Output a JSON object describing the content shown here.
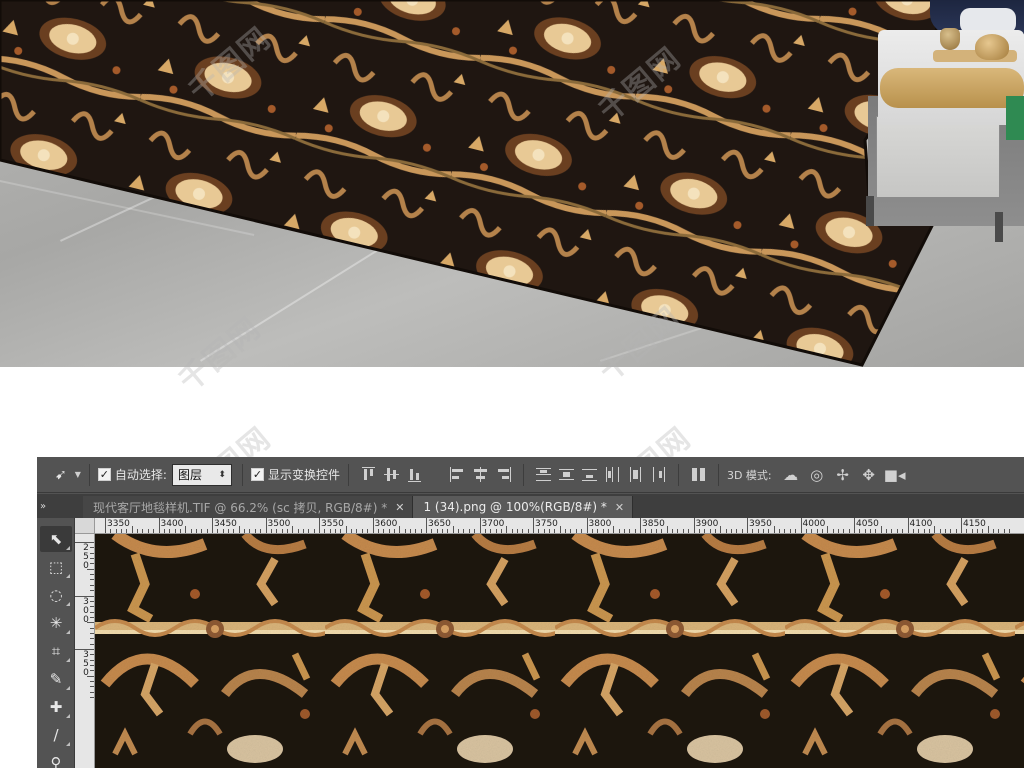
{
  "colors": {
    "rug_dark": "#1f1611",
    "rug_gold": "#c9975a",
    "rug_light": "#f0d8a8",
    "rug_rust": "#8a4a22",
    "ps_panel": "#535353",
    "ps_tabbar": "#3e3e3e",
    "ruler_bg": "#e6e6e6"
  },
  "watermark": {
    "text": "千图网"
  },
  "options_bar": {
    "move_tool_icon": "move-tool-icon",
    "auto_select_label": "自动选择:",
    "auto_select_checked": true,
    "auto_select_value": "图层",
    "show_transform_label": "显示变换控件",
    "show_transform_checked": true,
    "mode_3d_label": "3D 模式:"
  },
  "tabs": [
    {
      "label": "现代客厅地毯样机.TIF @ 66.2% (sc 拷贝, RGB/8#) *",
      "active": false
    },
    {
      "label": "1 (34).png @ 100%(RGB/8#) *",
      "active": true
    }
  ],
  "ruler": {
    "top_labels": [
      "3350",
      "3400",
      "3450",
      "3500",
      "3550",
      "3600",
      "3650",
      "3700",
      "3750",
      "3800",
      "3850",
      "3900",
      "3950",
      "4000",
      "4050",
      "4100",
      "4150"
    ],
    "left_labels": [
      "250",
      "300",
      "350"
    ]
  },
  "tools": [
    {
      "name": "move-tool",
      "glyph": "⬉",
      "selected": true
    },
    {
      "name": "marquee-tool",
      "glyph": "⬚",
      "selected": false
    },
    {
      "name": "lasso-tool",
      "glyph": "◌",
      "selected": false
    },
    {
      "name": "magic-wand-tool",
      "glyph": "✳",
      "selected": false
    },
    {
      "name": "crop-tool",
      "glyph": "⌗",
      "selected": false
    },
    {
      "name": "eyedropper-tool",
      "glyph": "✎",
      "selected": false
    },
    {
      "name": "healing-brush-tool",
      "glyph": "✚",
      "selected": false
    },
    {
      "name": "brush-tool",
      "glyph": "/",
      "selected": false
    },
    {
      "name": "stamp-tool",
      "glyph": "⚲",
      "selected": false
    }
  ]
}
